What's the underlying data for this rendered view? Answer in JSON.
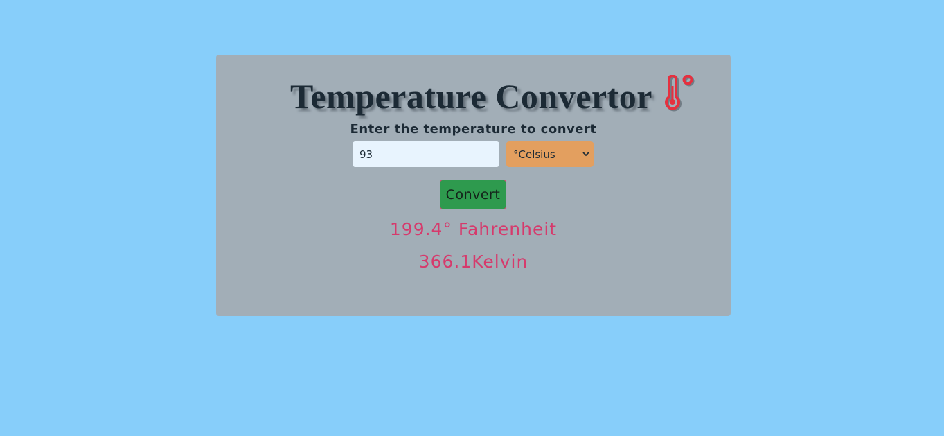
{
  "header": {
    "title": "Temperature Convertor",
    "title_icon": "thermometer-icon",
    "icon_color": "#e5303f"
  },
  "form": {
    "prompt": "Enter the temperature to convert",
    "input_value": "93",
    "selected_unit": "°Celsius",
    "convert_label": "Convert"
  },
  "results": {
    "fahrenheit": "199.4° Fahrenheit",
    "kelvin": "366.1Kelvin"
  },
  "colors": {
    "page_background": "#87cefa",
    "card_background": "#a2aeb7",
    "select_background": "#e39f5f",
    "button_background": "#2e9a4e",
    "result_text": "#d63a6c"
  }
}
